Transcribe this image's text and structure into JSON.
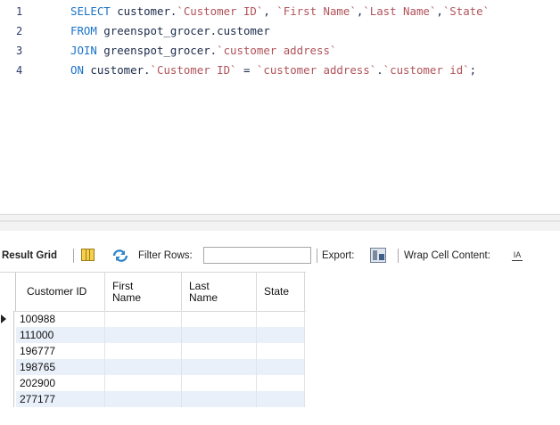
{
  "editor": {
    "lines": [
      {
        "num": "1",
        "parts": [
          [
            "kw",
            "SELECT"
          ],
          [
            "txt",
            " customer."
          ],
          [
            "str",
            "`Customer ID`"
          ],
          [
            "txt",
            ", "
          ],
          [
            "str",
            "`First Name`"
          ],
          [
            "txt",
            ","
          ],
          [
            "str",
            "`Last Name`"
          ],
          [
            "txt",
            ","
          ],
          [
            "str",
            "`State`"
          ]
        ]
      },
      {
        "num": "2",
        "parts": [
          [
            "kw",
            "FROM"
          ],
          [
            "txt",
            " greenspot_grocer.customer"
          ]
        ]
      },
      {
        "num": "3",
        "parts": [
          [
            "kw",
            "JOIN"
          ],
          [
            "txt",
            " greenspot_grocer."
          ],
          [
            "str",
            "`customer address`"
          ]
        ]
      },
      {
        "num": "4",
        "parts": [
          [
            "kw",
            "ON"
          ],
          [
            "txt",
            " customer."
          ],
          [
            "str",
            "`Customer ID`"
          ],
          [
            "txt",
            " = "
          ],
          [
            "str",
            "`customer address`"
          ],
          [
            "txt",
            "."
          ],
          [
            "str",
            "`customer id`"
          ],
          [
            "txt",
            ";"
          ]
        ]
      }
    ]
  },
  "toolbar": {
    "result_grid_label": "Result Grid",
    "filter_rows_label": "Filter Rows:",
    "filter_rows_value": "",
    "export_label": "Export:",
    "wrap_cell_label": "Wrap Cell Content:",
    "wrap_icon_text": "IA",
    "icons": [
      "grid-icon",
      "filter-icon",
      "export-icon",
      "wrap-icon"
    ]
  },
  "grid": {
    "columns": [
      "Customer ID",
      "First\nName",
      "Last\nName",
      "State"
    ],
    "rows": [
      [
        "100988",
        "",
        "",
        ""
      ],
      [
        "111000",
        "",
        "",
        ""
      ],
      [
        "196777",
        "",
        "",
        ""
      ],
      [
        "198765",
        "",
        "",
        ""
      ],
      [
        "202900",
        "",
        "",
        ""
      ],
      [
        "277177",
        "",
        "",
        ""
      ]
    ],
    "selected_row_index": 0
  },
  "colors": {
    "keyword": "#1a73c8",
    "string": "#b0535a",
    "alt_row": "#e9f0fa"
  }
}
